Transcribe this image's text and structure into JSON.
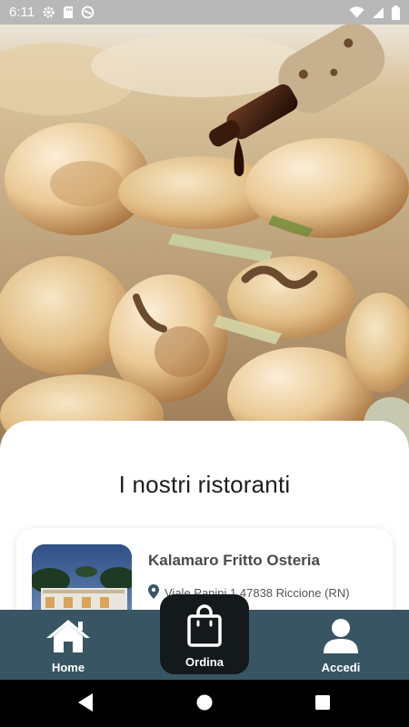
{
  "status_bar": {
    "time": "6:11",
    "left_icons": [
      "gear-icon",
      "sd-card-icon",
      "no-disturb-icon"
    ],
    "right_icons": [
      "wifi-icon",
      "signal-icon",
      "battery-icon"
    ]
  },
  "main": {
    "title": "I nostri ristoranti",
    "restaurants": [
      {
        "name": "Kalamaro Fritto Osteria",
        "address": "Viale Panini 1 47838 Riccione (RN)",
        "icon": "location-pin-icon"
      }
    ]
  },
  "bottom_nav": {
    "items": [
      {
        "label": "Home",
        "icon": "house-icon"
      },
      {
        "label": "Ordina",
        "icon": "shopping-bag-icon",
        "active": true
      },
      {
        "label": "Accedi",
        "icon": "user-icon"
      }
    ]
  },
  "system_nav": [
    "back-icon",
    "home-circle-icon",
    "recents-square-icon"
  ],
  "colors": {
    "status_bar": "#b8b8b8",
    "bottom_nav": "#385563",
    "active_tab": "#14191b",
    "system_nav": "#000000"
  }
}
